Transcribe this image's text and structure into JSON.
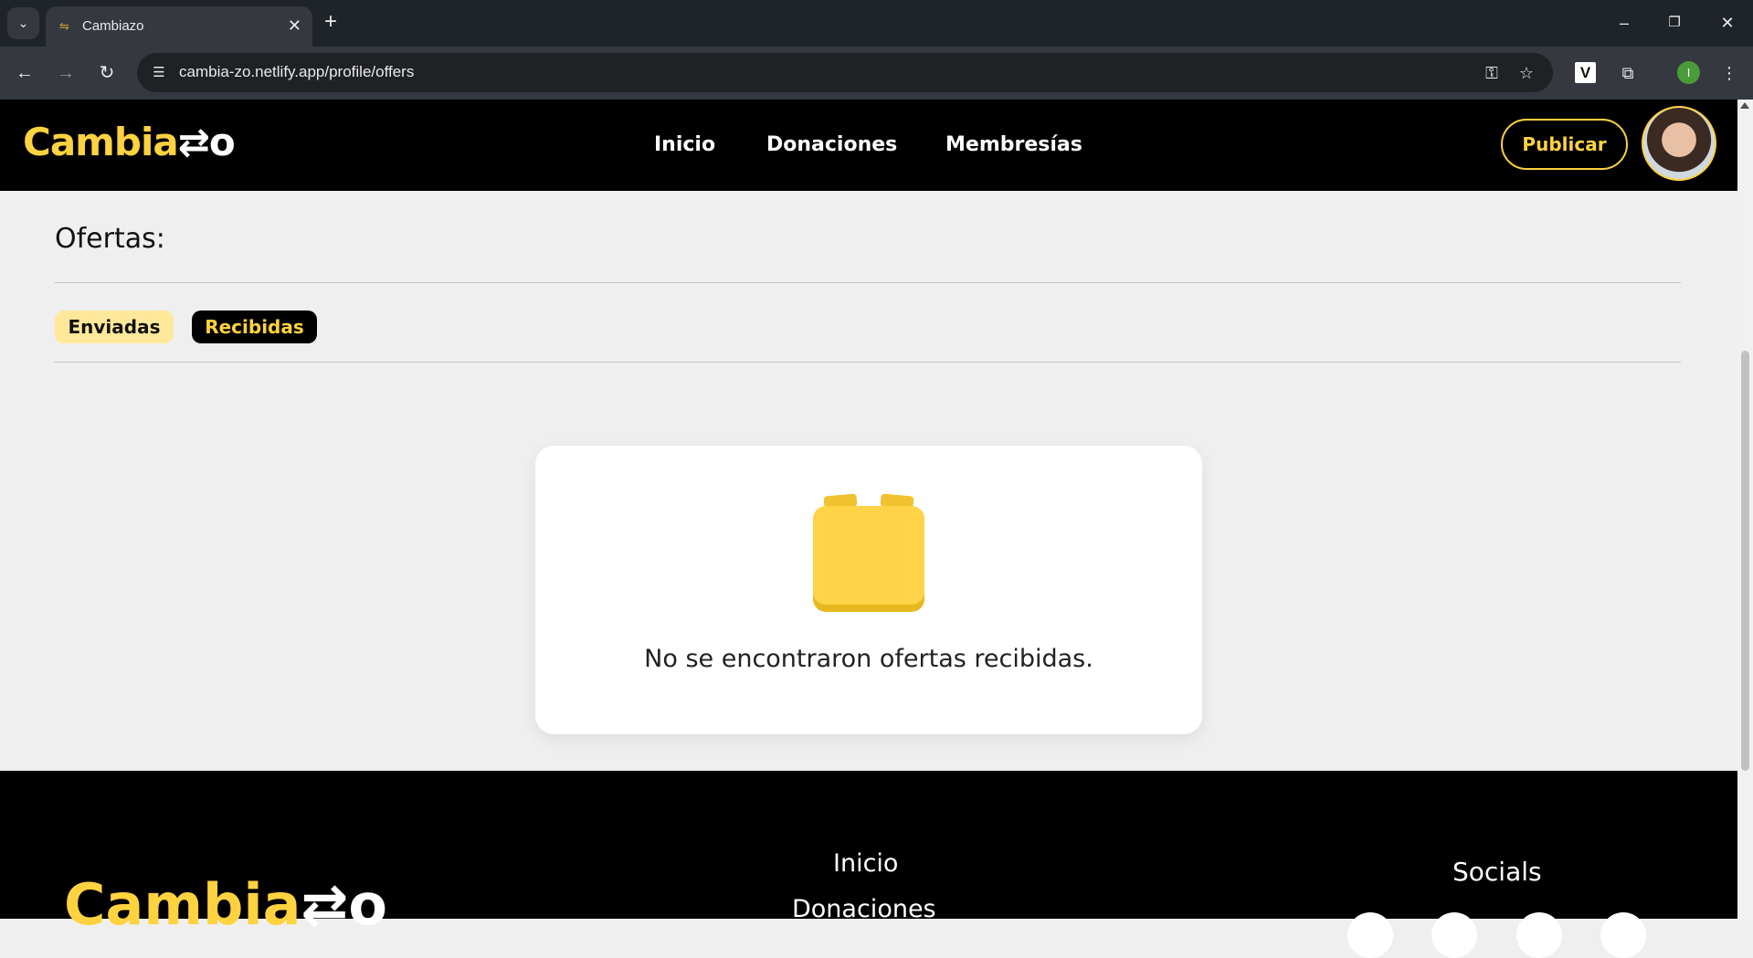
{
  "browser": {
    "tab_title": "Cambiazo",
    "url": "cambia-zo.netlify.app/profile/offers",
    "profile_initial": "I",
    "icons": {
      "tab_list": "chevron-down-icon",
      "favicon": "swap-arrows-icon",
      "close_tab": "close-icon",
      "new_tab": "plus-icon",
      "minimize": "minimize-icon",
      "restore": "restore-icon",
      "close_window": "close-icon",
      "back": "arrow-left-icon",
      "forward": "arrow-right-icon",
      "reload": "reload-icon",
      "site_info": "tune-icon",
      "password": "key-icon",
      "bookmark": "star-icon",
      "extension_v": "v-extension-icon",
      "extensions": "puzzle-icon",
      "menu": "kebab-menu-icon"
    }
  },
  "header": {
    "logo_main": "Cambia",
    "logo_tail": "⇄o",
    "nav": [
      "Inicio",
      "Donaciones",
      "Membresías"
    ],
    "publish_label": "Publicar"
  },
  "main": {
    "title": "Ofertas:",
    "tabs": [
      {
        "label": "Enviadas",
        "active": false
      },
      {
        "label": "Recibidas",
        "active": true
      }
    ],
    "empty_message": "No se encontraron ofertas recibidas.",
    "empty_icon": "empty-box-icon"
  },
  "footer": {
    "logo_main": "Cambia",
    "logo_tail": "⇄o",
    "links": [
      "Inicio",
      "Donaciones"
    ],
    "socials_heading": "Socials"
  },
  "colors": {
    "brand_yellow": "#ffd23f",
    "header_bg": "#000000",
    "page_bg": "#efefef"
  }
}
